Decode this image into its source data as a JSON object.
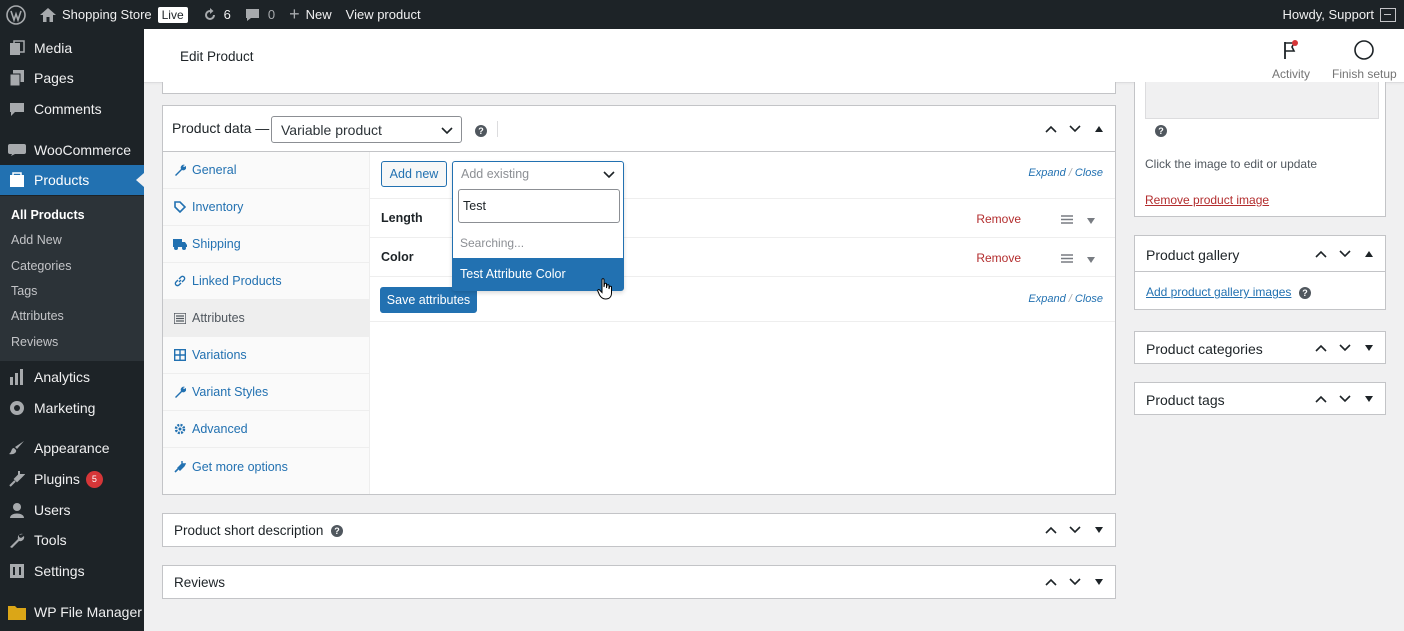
{
  "adminbar": {
    "site_name": "Shopping Store",
    "live_label": "Live",
    "updates_count": "6",
    "comments_count": "0",
    "new_label": "New",
    "view_product": "View product",
    "howdy": "Howdy, Support"
  },
  "sidebar": {
    "media": "Media",
    "pages": "Pages",
    "comments": "Comments",
    "woocommerce": "WooCommerce",
    "products": "Products",
    "sub": {
      "all_products": "All Products",
      "add_new": "Add New",
      "categories": "Categories",
      "tags": "Tags",
      "attributes": "Attributes",
      "reviews": "Reviews"
    },
    "analytics": "Analytics",
    "marketing": "Marketing",
    "appearance": "Appearance",
    "plugins": "Plugins",
    "plugins_badge": "5",
    "users": "Users",
    "tools": "Tools",
    "settings": "Settings",
    "wp_file_manager": "WP File Manager"
  },
  "header": {
    "title": "Edit Product",
    "activity": "Activity",
    "finish_setup": "Finish setup"
  },
  "product_data": {
    "title": "Product data —",
    "type_value": "Variable product",
    "tabs": {
      "general": "General",
      "inventory": "Inventory",
      "shipping": "Shipping",
      "linked": "Linked Products",
      "attributes": "Attributes",
      "variations": "Variations",
      "variant_styles": "Variant Styles",
      "advanced": "Advanced",
      "more": "Get more options"
    },
    "add_new": "Add new",
    "add_existing_placeholder": "Add existing",
    "expand": "Expand",
    "close": "Close",
    "expand_sep": "/",
    "attributes": [
      {
        "name": "Length",
        "remove": "Remove"
      },
      {
        "name": "Color",
        "remove": "Remove"
      }
    ],
    "save_attributes": "Save attributes"
  },
  "dropdown": {
    "search_value": "Test",
    "searching": "Searching...",
    "option": "Test Attribute Color"
  },
  "short_description": {
    "title": "Product short description"
  },
  "reviews": {
    "title": "Reviews"
  },
  "right": {
    "image_hint": "Click the image to edit or update",
    "remove_image": "Remove product image",
    "gallery_title": "Product gallery",
    "add_gallery": "Add product gallery images",
    "categories_title": "Product categories",
    "tags_title": "Product tags"
  },
  "colors": {
    "accent": "#2271b1",
    "admin_dark": "#1d2327",
    "remove_red": "#b32d2e",
    "badge_red": "#d63638"
  }
}
